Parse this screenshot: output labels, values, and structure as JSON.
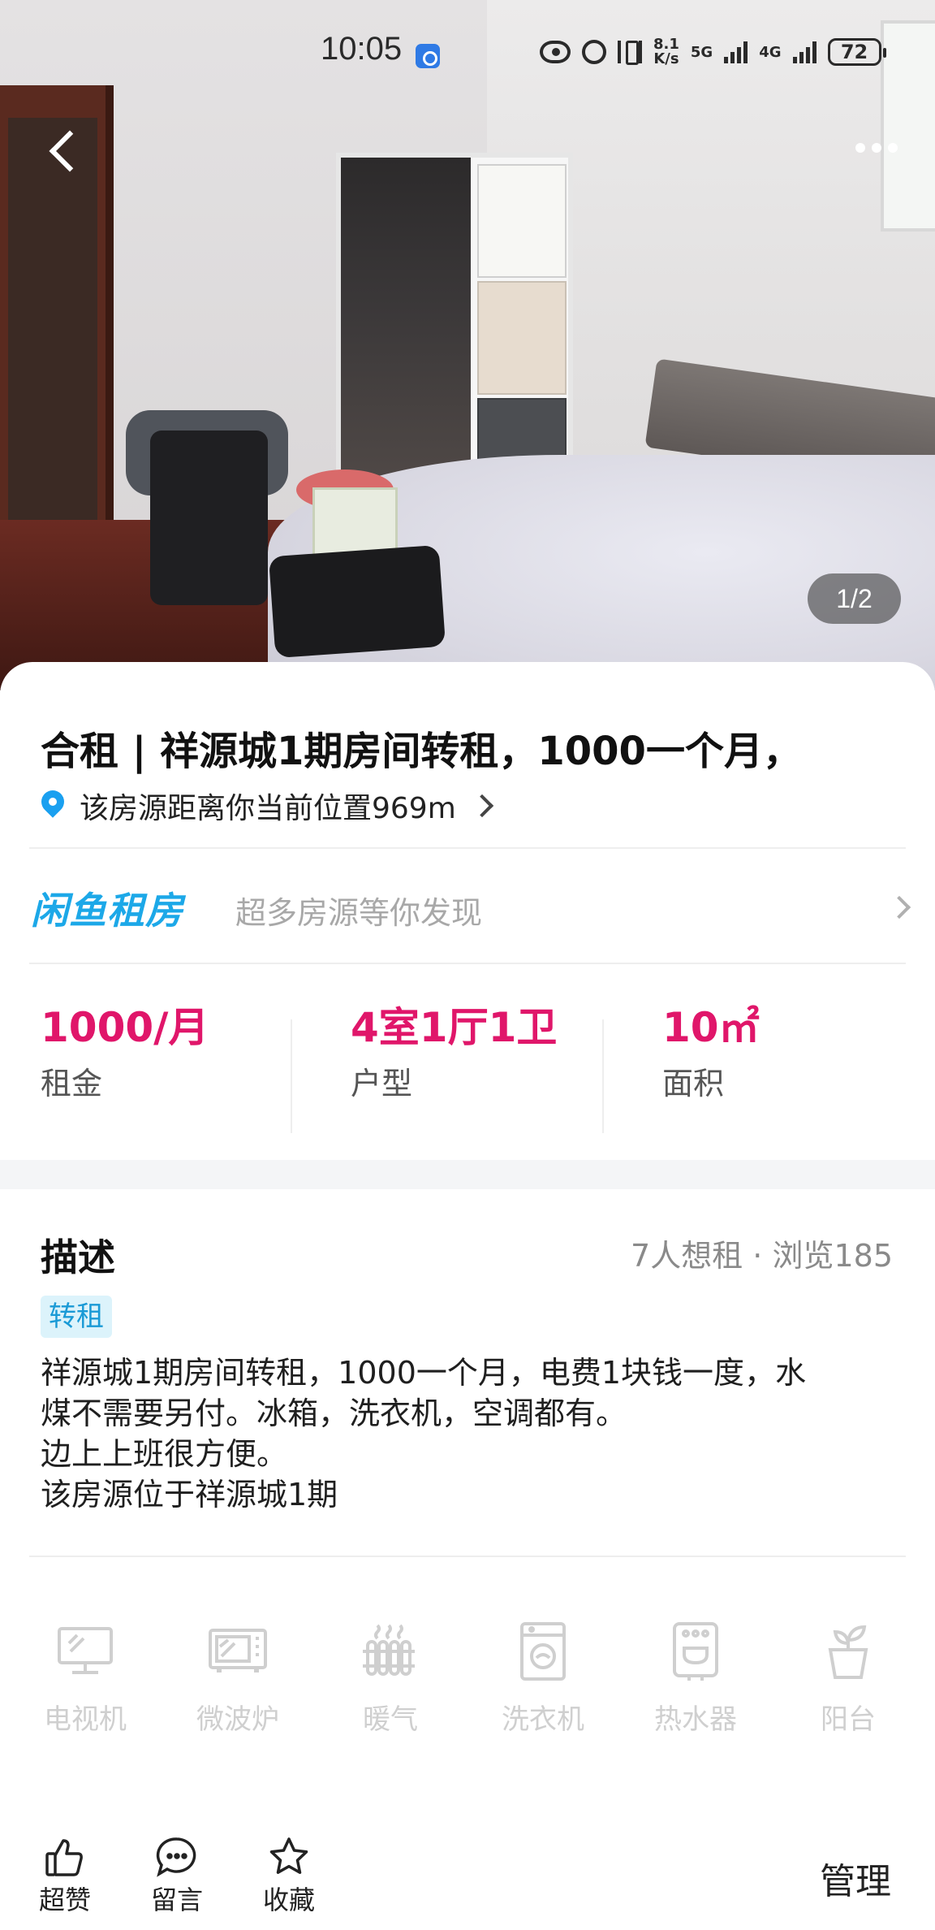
{
  "status_bar": {
    "time": "10:05",
    "speed_top": "8.1",
    "speed_unit": "K/s",
    "net1": "5G",
    "net2": "4G",
    "battery": "72"
  },
  "gallery": {
    "counter": "1/2"
  },
  "listing": {
    "title": "合租 | 祥源城1期房间转租，1000一个月，",
    "distance_text": "该房源距离你当前位置969m"
  },
  "brand": {
    "logo_text": "闲鱼租房",
    "tagline": "超多房源等你发现"
  },
  "stats": [
    {
      "value": "1000/月",
      "label": "租金"
    },
    {
      "value": "4室1厅1卫",
      "label": "户型"
    },
    {
      "value": "10㎡",
      "label": "面积"
    }
  ],
  "description": {
    "heading": "描述",
    "meta": "7人想租 · 浏览185",
    "tag": "转租",
    "lines": [
      "祥源城1期房间转租，1000一个月，电费1块钱一度，水",
      "煤不需要另付。冰箱，洗衣机，空调都有。",
      "边上上班很方便。",
      "该房源位于祥源城1期"
    ]
  },
  "amenities": [
    {
      "label": "电视机",
      "icon": "tv-icon"
    },
    {
      "label": "微波炉",
      "icon": "microwave-icon"
    },
    {
      "label": "暖气",
      "icon": "heater-icon"
    },
    {
      "label": "洗衣机",
      "icon": "washing-machine-icon"
    },
    {
      "label": "热水器",
      "icon": "water-heater-icon"
    },
    {
      "label": "阳台",
      "icon": "balcony-plant-icon"
    }
  ],
  "bottom_bar": {
    "like": "超赞",
    "comment": "留言",
    "favorite": "收藏",
    "manage": "管理"
  },
  "colors": {
    "accent_pink": "#e0166a",
    "brand_blue": "#1ca8e8",
    "pin_blue": "#1aa0f0",
    "tag_bg": "#dcf3fb"
  }
}
